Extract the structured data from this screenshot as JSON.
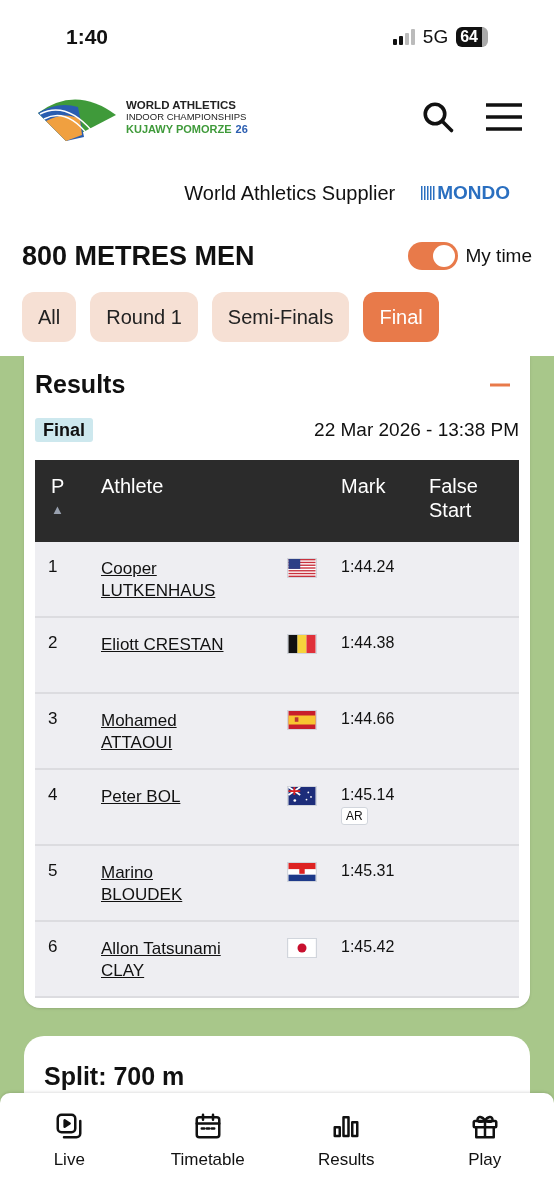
{
  "status_bar": {
    "time": "1:40",
    "network": "5G",
    "battery": "64"
  },
  "header": {
    "logo_lines": [
      "WORLD ATHLETICS",
      "INDOOR CHAMPIONSHIPS",
      "KUJAWY POMORZE",
      "26"
    ]
  },
  "supplier": {
    "label": "World Athletics Supplier",
    "brand": "MONDO"
  },
  "event": {
    "title": "800 METRES MEN",
    "my_time": {
      "label": "My time",
      "on": true
    }
  },
  "tabs": [
    {
      "label": "All",
      "selected": false
    },
    {
      "label": "Round 1",
      "selected": false
    },
    {
      "label": "Semi-Finals",
      "selected": false
    },
    {
      "label": "Final",
      "selected": true
    }
  ],
  "results": {
    "title": "Results",
    "expanded": true,
    "round_tag": "Final",
    "datetime": "22 Mar 2026 - 13:38 PM",
    "columns": [
      "P",
      "Athlete",
      "Mark",
      "False Start"
    ],
    "sort_indicator": "▲",
    "rows": [
      {
        "place": "1",
        "athlete": "Cooper LUTKENHAUS",
        "kind": "usa",
        "mark": "1:44.24"
      },
      {
        "place": "2",
        "athlete": "Eliott CRESTAN",
        "kind": "bel",
        "mark": "1:44.38"
      },
      {
        "place": "3",
        "athlete": "Mohamed ATTAOUI",
        "kind": "esp",
        "mark": "1:44.66"
      },
      {
        "place": "4",
        "athlete": "Peter BOL",
        "kind": "aus",
        "mark": "1:45.14",
        "record": "AR"
      },
      {
        "place": "5",
        "athlete": "Marino BLOUDEK",
        "kind": "cro",
        "mark": "1:45.31"
      },
      {
        "place": "6",
        "athlete": "Allon Tatsunami CLAY",
        "kind": "jpn",
        "mark": "1:45.42"
      }
    ]
  },
  "split": {
    "title": "Split: 700 m"
  },
  "bottom_nav": [
    {
      "label": "Live",
      "kind": "live"
    },
    {
      "label": "Timetable",
      "kind": "calendar"
    },
    {
      "label": "Results",
      "kind": "chart"
    },
    {
      "label": "Play",
      "kind": "gift"
    }
  ]
}
